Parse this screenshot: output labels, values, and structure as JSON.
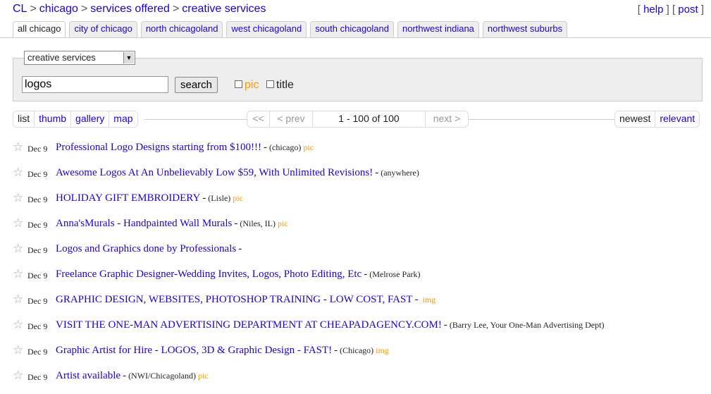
{
  "breadcrumb": [
    {
      "label": "CL"
    },
    {
      "label": "chicago"
    },
    {
      "label": "services offered"
    },
    {
      "label": "creative services"
    }
  ],
  "toplinks": {
    "help": "help",
    "post": "post"
  },
  "tabs": [
    {
      "label": "all chicago",
      "active": true
    },
    {
      "label": "city of chicago"
    },
    {
      "label": "north chicagoland"
    },
    {
      "label": "west chicagoland"
    },
    {
      "label": "south chicagoland"
    },
    {
      "label": "northwest indiana"
    },
    {
      "label": "northwest suburbs"
    }
  ],
  "search": {
    "category": "creative services",
    "query": "logos",
    "button_label": "search",
    "pic_label": "pic",
    "title_label": "title"
  },
  "views": [
    "list",
    "thumb",
    "gallery",
    "map"
  ],
  "pager": {
    "first": "<<",
    "prev": "< prev",
    "range": "1 - 100 of 100",
    "next": "next >"
  },
  "sort": [
    "newest",
    "relevant"
  ],
  "listings": [
    {
      "date": "Dec 9",
      "title": "Professional Logo Designs starting from $100!!!",
      "location": "(chicago)",
      "tag": "pic"
    },
    {
      "date": "Dec 9",
      "title": "Awesome Logos At An Unbelievably Low $59, With Unlimited Revisions!",
      "location": "(anywhere)",
      "tag": ""
    },
    {
      "date": "Dec 9",
      "title": "HOLIDAY GIFT EMBROIDERY",
      "location": "(Lisle)",
      "tag": "pic"
    },
    {
      "date": "Dec 9",
      "title": "Anna'sMurals - Handpainted Wall Murals",
      "location": "(Niles, IL)",
      "tag": "pic"
    },
    {
      "date": "Dec 9",
      "title": "Logos and Graphics done by Professionals",
      "location": "",
      "tag": ""
    },
    {
      "date": "Dec 9",
      "title": "Freelance Graphic Designer-Wedding Invites, Logos, Photo Editing, Etc",
      "location": "(Melrose Park)",
      "tag": ""
    },
    {
      "date": "Dec 9",
      "title": "GRAPHIC DESIGN, WEBSITES, PHOTOSHOP TRAINING - LOW COST, FAST",
      "location": "",
      "tag": "img"
    },
    {
      "date": "Dec 9",
      "title": "VISIT THE ONE-MAN ADVERTISING DEPARTMENT AT CHEAPADAGENCY.COM!",
      "location": "(Barry Lee, Your One-Man Advertising Dept)",
      "tag": ""
    },
    {
      "date": "Dec 9",
      "title": "Graphic Artist for Hire - LOGOS, 3D & Graphic Design - FAST!",
      "location": "(Chicago)",
      "tag": "img"
    },
    {
      "date": "Dec 9",
      "title": "Artist available",
      "location": "(NWI/Chicagoland)",
      "tag": "pic"
    }
  ]
}
